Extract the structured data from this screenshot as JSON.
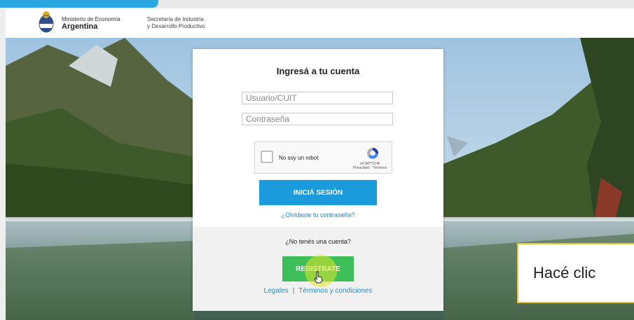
{
  "header": {
    "ministry_line1": "Ministerio de Economía",
    "ministry_line2": "Argentina",
    "secretary_line1": "Secretaría de Industria",
    "secretary_line2": "y Desarrollo Productivo"
  },
  "login": {
    "title": "Ingresá a tu cuenta",
    "username_placeholder": "Usuario/CUIT",
    "password_placeholder": "Contraseña",
    "captcha_label": "No soy un robot",
    "captcha_brand": "reCAPTCHA",
    "captcha_links": "Privacidad - Términos",
    "login_button": "INICIÁ SESIÓN",
    "forgot_link": "¿Olvidaste tu contraseña?",
    "no_account": "¿No tenés una cuenta?",
    "register_button": "REGISTRATE",
    "legal_link": "Legales",
    "separator": "|",
    "terms_link": "Términos y condiciones"
  },
  "caption": {
    "text": "Hacé clic"
  },
  "colors": {
    "accent_blue": "#1b9bdb",
    "register_green": "#3fbf5a",
    "link_blue": "#1a8fd1",
    "caption_border": "#e8c63a"
  },
  "icons": [
    "argentina-crest-icon",
    "recaptcha-icon",
    "pointer-cursor-icon"
  ]
}
